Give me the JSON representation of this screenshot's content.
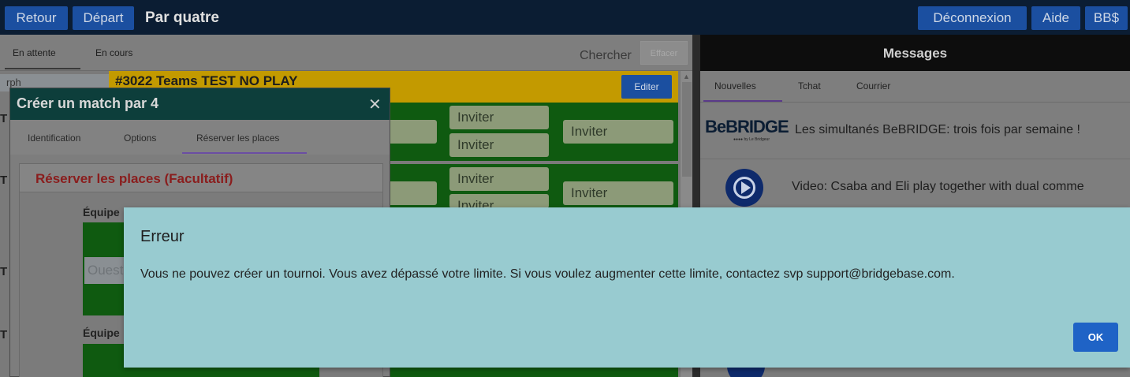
{
  "topbar": {
    "back": "Retour",
    "start": "Départ",
    "title": "Par quatre",
    "logout": "Déconnexion",
    "help": "Aide",
    "bbdollars": "BB$"
  },
  "left": {
    "tabs": [
      "En attente",
      "En cours"
    ],
    "search_placeholder": "Chercher",
    "clear": "Effacer",
    "row_user": "rph",
    "tourney_title": "#3022 Teams TEST NO PLAY",
    "edit": "Editer",
    "invite": "Inviter"
  },
  "dialog": {
    "title": "Créer un match par 4",
    "tabs": [
      "Identification",
      "Options",
      "Réserver les places"
    ],
    "section_title": "Réserver les places (Facultatif)",
    "team_label": "Équipe",
    "west_placeholder": "Ouest"
  },
  "right": {
    "title": "Messages",
    "tabs": [
      "Nouvelles",
      "Tchat",
      "Courrier"
    ],
    "news": [
      {
        "logo": "BeBRIDGE",
        "logo_sub": "●●●● by Le Bridgeur",
        "text": "Les simultanés BeBRIDGE: trois fois par semaine !"
      },
      {
        "icon": "video-reel-icon",
        "text": "Video: Csaba and Eli play together with dual comme"
      }
    ]
  },
  "error": {
    "title": "Erreur",
    "message": "Vous ne pouvez créer un tournoi. Vous avez dépassé votre limite. Si vous voulez augmenter cette limite, contactez svp support@bridgebase.com.",
    "ok": "OK"
  },
  "colors": {
    "topbar": "#0b1d33",
    "button": "#1b4fa0",
    "green_table": "#0f5a10",
    "error_bg": "#98cbd0",
    "ok_button": "#1f63c6"
  }
}
